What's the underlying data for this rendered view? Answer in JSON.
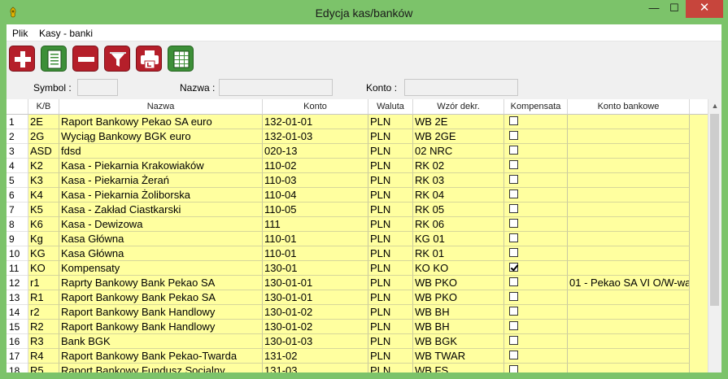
{
  "window": {
    "title": "Edycja kas/banków",
    "min_glyph": "—",
    "max_glyph": "☐",
    "close_glyph": "✕"
  },
  "menu": [
    {
      "label": "Plik"
    },
    {
      "label": "Kasy - banki"
    }
  ],
  "toolbar": [
    {
      "name": "add-icon",
      "color": "#b51f2a"
    },
    {
      "name": "edit-document-icon",
      "color": "#3d8f38"
    },
    {
      "name": "remove-icon",
      "color": "#b51f2a"
    },
    {
      "name": "filter-icon",
      "color": "#b51f2a"
    },
    {
      "name": "print-icon",
      "color": "#b51f2a"
    },
    {
      "name": "table-icon",
      "color": "#3d8f38"
    }
  ],
  "filters": {
    "symbol_label": "Symbol :",
    "symbol_value": "",
    "nazwa_label": "Nazwa :",
    "nazwa_value": "",
    "konto_label": "Konto :",
    "konto_value": ""
  },
  "table": {
    "columns": [
      "K/B",
      "Nazwa",
      "Konto",
      "Waluta",
      "Wzór dekr.",
      "Kompensata",
      "Konto bankowe"
    ],
    "row_color": "#ffff9f",
    "rows": [
      {
        "n": "1",
        "kb": "2E",
        "nazwa": "Raport Bankowy Pekao SA euro",
        "konto": "132-01-01",
        "waluta": "PLN",
        "wzor": "WB 2E",
        "kompensata": false,
        "konto_bankowe": ""
      },
      {
        "n": "2",
        "kb": "2G",
        "nazwa": "Wyciąg Bankowy BGK euro",
        "konto": "132-01-03",
        "waluta": "PLN",
        "wzor": "WB 2GE",
        "kompensata": false,
        "konto_bankowe": ""
      },
      {
        "n": "3",
        "kb": "ASD",
        "nazwa": "fdsd",
        "konto": "020-13",
        "waluta": "PLN",
        "wzor": "02 NRC",
        "kompensata": false,
        "konto_bankowe": ""
      },
      {
        "n": "4",
        "kb": "K2",
        "nazwa": "Kasa - Piekarnia Krakowiaków",
        "konto": "110-02",
        "waluta": "PLN",
        "wzor": "RK 02",
        "kompensata": false,
        "konto_bankowe": ""
      },
      {
        "n": "5",
        "kb": "K3",
        "nazwa": "Kasa - Piekarnia Żerań",
        "konto": "110-03",
        "waluta": "PLN",
        "wzor": "RK 03",
        "kompensata": false,
        "konto_bankowe": ""
      },
      {
        "n": "6",
        "kb": "K4",
        "nazwa": "Kasa - Piekarnia Żoliborska",
        "konto": "110-04",
        "waluta": "PLN",
        "wzor": "RK 04",
        "kompensata": false,
        "konto_bankowe": ""
      },
      {
        "n": "7",
        "kb": "K5",
        "nazwa": "Kasa - Zakład Ciastkarski",
        "konto": "110-05",
        "waluta": "PLN",
        "wzor": "RK 05",
        "kompensata": false,
        "konto_bankowe": ""
      },
      {
        "n": "8",
        "kb": "K6",
        "nazwa": "Kasa - Dewizowa",
        "konto": "111",
        "waluta": "PLN",
        "wzor": "RK 06",
        "kompensata": false,
        "konto_bankowe": ""
      },
      {
        "n": "9",
        "kb": "Kg",
        "nazwa": "Kasa Główna",
        "konto": "110-01",
        "waluta": "PLN",
        "wzor": "KG 01",
        "kompensata": false,
        "konto_bankowe": ""
      },
      {
        "n": "10",
        "kb": "KG",
        "nazwa": "Kasa Główna",
        "konto": "110-01",
        "waluta": "PLN",
        "wzor": "RK 01",
        "kompensata": false,
        "konto_bankowe": ""
      },
      {
        "n": "11",
        "kb": "KO",
        "nazwa": "Kompensaty",
        "konto": "130-01",
        "waluta": "PLN",
        "wzor": "KO KO",
        "kompensata": true,
        "konto_bankowe": ""
      },
      {
        "n": "12",
        "kb": "r1",
        "nazwa": "Raprty Bankowy Bank Pekao SA",
        "konto": "130-01-01",
        "waluta": "PLN",
        "wzor": "WB PKO",
        "kompensata": false,
        "konto_bankowe": "01 - Pekao SA VI O/W-wa"
      },
      {
        "n": "13",
        "kb": "R1",
        "nazwa": "Raport Bankowy Bank Pekao SA",
        "konto": "130-01-01",
        "waluta": "PLN",
        "wzor": "WB PKO",
        "kompensata": false,
        "konto_bankowe": ""
      },
      {
        "n": "14",
        "kb": "r2",
        "nazwa": "Raport Bankowy Bank Handlowy",
        "konto": "130-01-02",
        "waluta": "PLN",
        "wzor": "WB BH",
        "kompensata": false,
        "konto_bankowe": ""
      },
      {
        "n": "15",
        "kb": "R2",
        "nazwa": "Raport Bankowy Bank Handlowy",
        "konto": "130-01-02",
        "waluta": "PLN",
        "wzor": "WB BH",
        "kompensata": false,
        "konto_bankowe": ""
      },
      {
        "n": "16",
        "kb": "R3",
        "nazwa": "Bank BGK",
        "konto": "130-01-03",
        "waluta": "PLN",
        "wzor": "WB BGK",
        "kompensata": false,
        "konto_bankowe": ""
      },
      {
        "n": "17",
        "kb": "R4",
        "nazwa": "Raport Bankowy Bank Pekao-Twarda",
        "konto": "131-02",
        "waluta": "PLN",
        "wzor": "WB TWAR",
        "kompensata": false,
        "konto_bankowe": ""
      },
      {
        "n": "18",
        "kb": "R5",
        "nazwa": "Raport Bankowy Fundusz Socjalny",
        "konto": "131-03",
        "waluta": "PLN",
        "wzor": "WB FS",
        "kompensata": false,
        "konto_bankowe": ""
      }
    ]
  }
}
